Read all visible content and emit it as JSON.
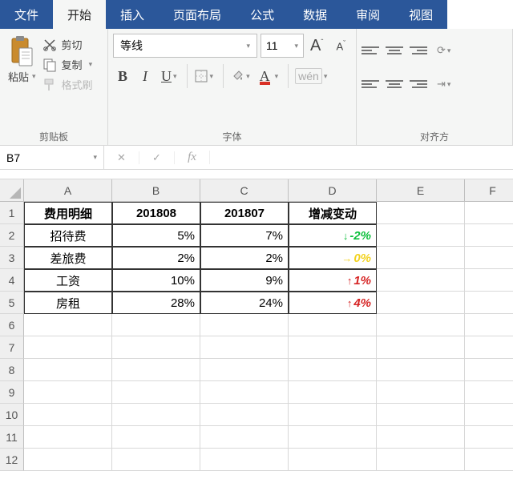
{
  "tabs": {
    "file": "文件",
    "home": "开始",
    "insert": "插入",
    "layout": "页面布局",
    "formula": "公式",
    "data": "数据",
    "review": "审阅",
    "view": "视图"
  },
  "ribbon": {
    "clipboard": {
      "group_label": "剪贴板",
      "paste": "粘贴",
      "cut": "剪切",
      "copy": "复制",
      "format_painter": "格式刷"
    },
    "font": {
      "group_label": "字体",
      "font_name": "等线",
      "font_size": "11",
      "bold": "B",
      "italic": "I",
      "underline": "U",
      "font_color_letter": "A",
      "phonetic": "wén"
    },
    "alignment": {
      "group_label": "对齐方"
    }
  },
  "formula_bar": {
    "name_box": "B7",
    "fx": "fx",
    "value": ""
  },
  "columns": [
    "A",
    "B",
    "C",
    "D",
    "E",
    "F"
  ],
  "rows": [
    "1",
    "2",
    "3",
    "4",
    "5",
    "6",
    "7",
    "8",
    "9",
    "10",
    "11",
    "12"
  ],
  "table": {
    "headers": {
      "A": "费用明细",
      "B": "201808",
      "C": "201807",
      "D": "增减变动"
    },
    "rows": [
      {
        "A": "招待费",
        "B": "5%",
        "C": "7%",
        "D": {
          "arrow": "↓",
          "text": "-2%",
          "cls": "neg"
        }
      },
      {
        "A": "差旅费",
        "B": "2%",
        "C": "2%",
        "D": {
          "arrow": "→",
          "text": "0%",
          "cls": "zero"
        }
      },
      {
        "A": "工资",
        "B": "10%",
        "C": "9%",
        "D": {
          "arrow": "↑",
          "text": "1%",
          "cls": "pos"
        }
      },
      {
        "A": "房租",
        "B": "28%",
        "C": "24%",
        "D": {
          "arrow": "↑",
          "text": "4%",
          "cls": "pos"
        }
      }
    ]
  },
  "chart_data": {
    "type": "table",
    "title": "费用明细 期间占比与增减变动",
    "columns": [
      "费用明细",
      "201808",
      "201807",
      "增减变动"
    ],
    "rows": [
      {
        "费用明细": "招待费",
        "201808": 0.05,
        "201807": 0.07,
        "增减变动": -0.02
      },
      {
        "费用明细": "差旅费",
        "201808": 0.02,
        "201807": 0.02,
        "增减变动": 0.0
      },
      {
        "费用明细": "工资",
        "201808": 0.1,
        "201807": 0.09,
        "增减变动": 0.01
      },
      {
        "费用明细": "房租",
        "201808": 0.28,
        "201807": 0.24,
        "增减变动": 0.04
      }
    ]
  }
}
